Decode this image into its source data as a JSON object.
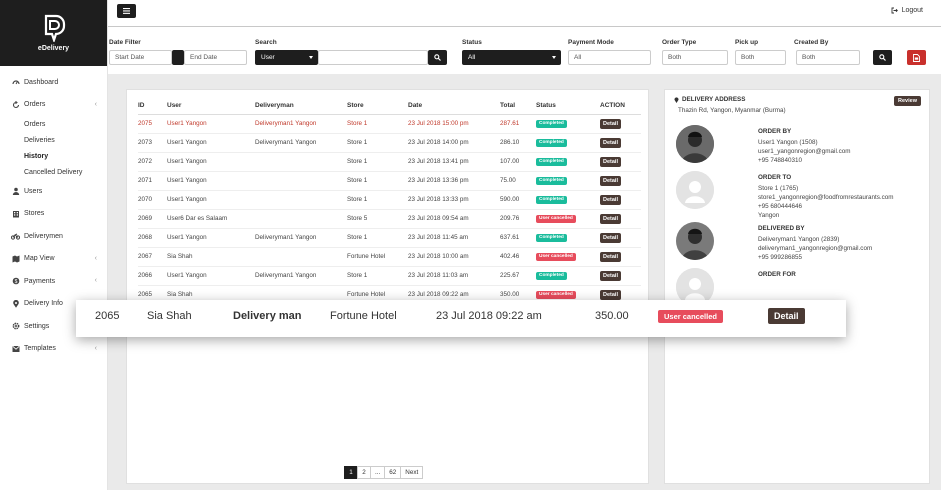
{
  "brand": {
    "name": "eDelivery"
  },
  "sidebar": {
    "items": [
      {
        "label": "Dashboard",
        "icon": "dashboard-icon"
      },
      {
        "label": "Orders",
        "icon": "refresh-icon",
        "expandable": true
      },
      {
        "label": "Users",
        "icon": "user-icon"
      },
      {
        "label": "Stores",
        "icon": "store-icon"
      },
      {
        "label": "Deliverymen",
        "icon": "motorbike-icon"
      },
      {
        "label": "Map View",
        "icon": "map-icon",
        "expandable": true
      },
      {
        "label": "Payments",
        "icon": "payment-icon",
        "expandable": true
      },
      {
        "label": "Delivery Info",
        "icon": "pin-icon"
      },
      {
        "label": "Settings",
        "icon": "gear-icon"
      },
      {
        "label": "Templates",
        "icon": "template-icon",
        "expandable": true
      }
    ],
    "orders_sub": [
      "Orders",
      "Deliveries",
      "History",
      "Cancelled Delivery"
    ],
    "active_sub": "History"
  },
  "topbar": {
    "logout_label": "Logout"
  },
  "filters": {
    "date_label": "Date Filter",
    "start_placeholder": "Start Date",
    "end_placeholder": "End Date",
    "search_label": "Search",
    "search_type": "User",
    "status_label": "Status",
    "status_value": "All",
    "payment_label": "Payment Mode",
    "payment_value": "All",
    "order_type_label": "Order Type",
    "order_type_value": "Both",
    "pickup_label": "Pick up",
    "pickup_value": "Both",
    "created_by_label": "Created By",
    "created_by_value": "Both"
  },
  "table": {
    "headers": [
      "ID",
      "User",
      "Deliveryman",
      "Store",
      "Date",
      "Total",
      "Status",
      "ACTION"
    ],
    "action_label": "Detail",
    "rows": [
      {
        "id": "2075",
        "user": "User1 Yangon",
        "deliveryman": "Deliveryman1 Yangon",
        "store": "Store 1",
        "date": "23 Jul 2018 15:00 pm",
        "total": "287.61",
        "status": "Completed",
        "highlight": true
      },
      {
        "id": "2073",
        "user": "User1 Yangon",
        "deliveryman": "Deliveryman1 Yangon",
        "store": "Store 1",
        "date": "23 Jul 2018 14:00 pm",
        "total": "286.10",
        "status": "Completed"
      },
      {
        "id": "2072",
        "user": "User1 Yangon",
        "deliveryman": "",
        "store": "Store 1",
        "date": "23 Jul 2018 13:41 pm",
        "total": "107.00",
        "status": "Completed"
      },
      {
        "id": "2071",
        "user": "User1 Yangon",
        "deliveryman": "",
        "store": "Store 1",
        "date": "23 Jul 2018 13:36 pm",
        "total": "75.00",
        "status": "Completed"
      },
      {
        "id": "2070",
        "user": "User1 Yangon",
        "deliveryman": "",
        "store": "Store 1",
        "date": "23 Jul 2018 13:33 pm",
        "total": "590.00",
        "status": "Completed"
      },
      {
        "id": "2069",
        "user": "User6 Dar es Salaam",
        "deliveryman": "",
        "store": "Store 5",
        "date": "23 Jul 2018 09:54 am",
        "total": "209.76",
        "status": "User cancelled"
      },
      {
        "id": "2068",
        "user": "User1 Yangon",
        "deliveryman": "Deliveryman1 Yangon",
        "store": "Store 1",
        "date": "23 Jul 2018 11:45 am",
        "total": "637.61",
        "status": "Completed"
      },
      {
        "id": "2067",
        "user": "Sia Shah",
        "deliveryman": "",
        "store": "Fortune Hotel",
        "date": "23 Jul 2018 10:00 am",
        "total": "402.46",
        "status": "User cancelled"
      },
      {
        "id": "2066",
        "user": "User1 Yangon",
        "deliveryman": "Deliveryman1 Yangon",
        "store": "Store 1",
        "date": "23 Jul 2018 11:03 am",
        "total": "225.67",
        "status": "Completed"
      },
      {
        "id": "2065",
        "user": "Sia Shah",
        "deliveryman": "",
        "store": "Fortune Hotel",
        "date": "23 Jul 2018 09:22 am",
        "total": "350.00",
        "status": "User cancelled"
      }
    ]
  },
  "pagination": {
    "pages": [
      "1",
      "2",
      "...",
      "62"
    ],
    "next": "Next",
    "current": "1"
  },
  "detail": {
    "address_title": "DELIVERY ADDRESS",
    "address": "Thazin Rd, Yangon, Myanmar (Burma)",
    "review_label": "Review",
    "order_by": {
      "title": "ORDER BY",
      "lines": [
        "User1 Yangon (1508)",
        "user1_yangonregion@gmail.com",
        "+95 748840310"
      ]
    },
    "order_to": {
      "title": "ORDER TO",
      "lines": [
        "Store 1 (1765)",
        "store1_yangonregion@foodfromrestaurants.com",
        "+95 680444646",
        "Yangon"
      ]
    },
    "delivered_by": {
      "title": "DELIVERED BY",
      "lines": [
        "Deliveryman1 Yangon (2839)",
        "deliveryman1_yangonregion@gmail.com",
        "+95 999286855"
      ]
    },
    "order_for": {
      "title": "ORDER FOR",
      "lines": []
    }
  },
  "zoom_row": {
    "id": "2065",
    "user": "Sia Shah",
    "deliveryman": "Delivery man",
    "store": "Fortune Hotel",
    "date": "23 Jul 2018 09:22 am",
    "total": "350.00",
    "status": "User cancelled",
    "action": "Detail"
  },
  "colors": {
    "dark": "#1e1e1e",
    "completed": "#1abc9c",
    "cancelled": "#e74c5c",
    "detail_button": "#4a3a34",
    "highlight_text": "#c0392b"
  }
}
